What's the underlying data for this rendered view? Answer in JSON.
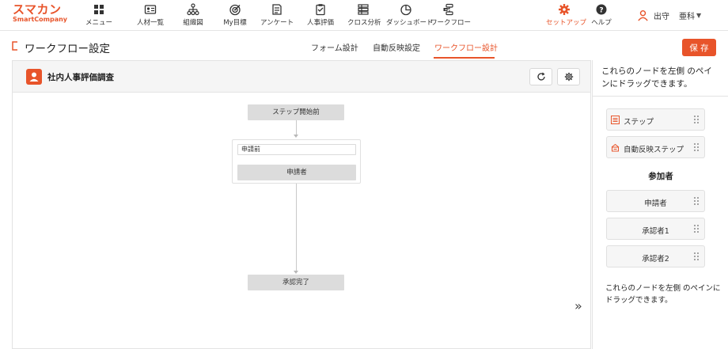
{
  "brand": {
    "name_ja": "スマカン",
    "name_en": "SmartCompany",
    "accent": "#e8542a"
  },
  "nav": {
    "items": [
      {
        "label": "メニュー",
        "icon": "grid-icon"
      },
      {
        "label": "人材一覧",
        "icon": "id-card-icon"
      },
      {
        "label": "組織図",
        "icon": "org-chart-icon"
      },
      {
        "label": "My目標",
        "icon": "target-icon"
      },
      {
        "label": "アンケート",
        "icon": "survey-icon"
      },
      {
        "label": "人事評価",
        "icon": "clipboard-icon"
      },
      {
        "label": "クロス分析",
        "icon": "cross-analysis-icon"
      },
      {
        "label": "ダッシュボード",
        "icon": "dashboard-icon"
      },
      {
        "label": "ワークフロー",
        "icon": "workflow-icon"
      }
    ],
    "setup": {
      "label": "セットアップ",
      "icon": "gear-icon"
    },
    "help": {
      "label": "ヘルプ",
      "icon": "help-icon"
    },
    "user": {
      "name": "出守",
      "department": "亜科"
    }
  },
  "page": {
    "title": "ワークフロー設定",
    "tabs": [
      {
        "label": "フォーム設計",
        "active": false
      },
      {
        "label": "自動反映設定",
        "active": false
      },
      {
        "label": "ワークフロー設計",
        "active": true
      }
    ],
    "save_label": "保 存"
  },
  "canvas": {
    "form_title": "社内人事評価調査",
    "start_label": "ステップ開始前",
    "step": {
      "name": "申請前",
      "participant": "申請者"
    },
    "end_label": "承認完了",
    "expand_symbol": "»"
  },
  "palette": {
    "hint_top": "これらのノードを左側 のペインにドラッグできます。",
    "nodes": [
      {
        "label": "ステップ",
        "icon": "step-icon"
      },
      {
        "label": "自動反映ステップ",
        "icon": "auto-reflect-icon"
      }
    ],
    "participants_title": "参加者",
    "participants": [
      {
        "label": "申請者"
      },
      {
        "label": "承認者1"
      },
      {
        "label": "承認者2"
      }
    ],
    "hint_bottom": "これらのノードを左側 のペインにドラッグできます。"
  }
}
